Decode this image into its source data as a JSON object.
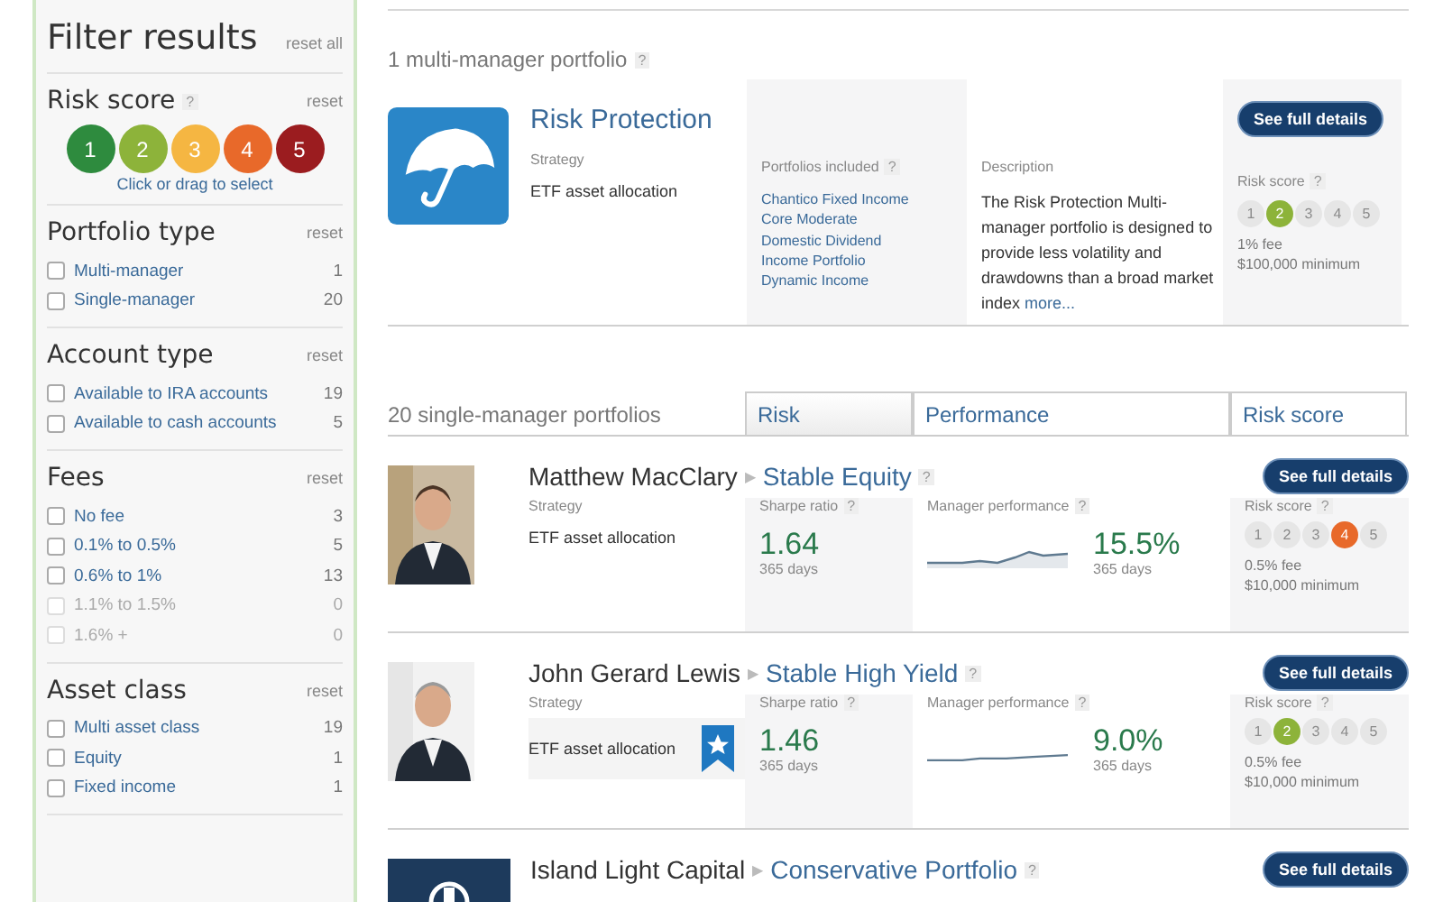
{
  "sidebar": {
    "title": "Filter results",
    "reset_all": "reset all",
    "risk": {
      "title": "Risk score",
      "help": "?",
      "reset": "reset",
      "scores": [
        {
          "label": "1",
          "color": "#2e8b3e"
        },
        {
          "label": "2",
          "color": "#8db33a"
        },
        {
          "label": "3",
          "color": "#f5b642"
        },
        {
          "label": "4",
          "color": "#e8692a"
        },
        {
          "label": "5",
          "color": "#9b1c1f"
        }
      ],
      "hint": "Click or drag to select"
    },
    "groups": [
      {
        "title": "Portfolio type",
        "reset": "reset",
        "options": [
          {
            "label": "Multi-manager",
            "count": "1",
            "checked": false,
            "disabled": false
          },
          {
            "label": "Single-manager",
            "count": "20",
            "checked": false,
            "disabled": false
          }
        ]
      },
      {
        "title": "Account type",
        "reset": "reset",
        "options": [
          {
            "label": "Available to IRA accounts",
            "count": "19",
            "checked": false,
            "disabled": false
          },
          {
            "label": "Available to cash accounts",
            "count": "5",
            "checked": false,
            "disabled": false
          }
        ]
      },
      {
        "title": "Fees",
        "reset": "reset",
        "options": [
          {
            "label": "No fee",
            "count": "3",
            "checked": false,
            "disabled": false
          },
          {
            "label": "0.1% to 0.5%",
            "count": "5",
            "checked": false,
            "disabled": false
          },
          {
            "label": "0.6% to 1%",
            "count": "13",
            "checked": false,
            "disabled": false
          },
          {
            "label": "1.1% to 1.5%",
            "count": "0",
            "checked": false,
            "disabled": true
          },
          {
            "label": "1.6% +",
            "count": "0",
            "checked": false,
            "disabled": true
          }
        ]
      },
      {
        "title": "Asset class",
        "reset": "reset",
        "options": [
          {
            "label": "Multi asset class",
            "count": "19",
            "checked": false,
            "disabled": false
          },
          {
            "label": "Equity",
            "count": "1",
            "checked": false,
            "disabled": false
          },
          {
            "label": "Fixed income",
            "count": "1",
            "checked": false,
            "disabled": false
          }
        ]
      }
    ]
  },
  "multi": {
    "heading": "1 multi-manager portfolio",
    "help": "?",
    "card": {
      "name": "Risk Protection",
      "strategy_label": "Strategy",
      "strategy": "ETF asset allocation",
      "portfolios_label": "Portfolios included",
      "portfolios_help": "?",
      "risk_help": "?",
      "portfolios": [
        "Chantico Fixed Income",
        "Core Moderate",
        "Domestic Dividend",
        "Income Portfolio",
        "Dynamic Income"
      ],
      "description_label": "Description",
      "description": "The Risk Protection Multi-manager portfolio is designed to provide less volatility and drawdowns than a broad market index",
      "more": "more...",
      "button": "See full details",
      "risk_label": "Risk score",
      "risk_dots": [
        {
          "label": "1",
          "selected": false
        },
        {
          "label": "2",
          "selected": true
        },
        {
          "label": "3",
          "selected": false
        },
        {
          "label": "4",
          "selected": false
        },
        {
          "label": "5",
          "selected": false
        }
      ],
      "fee": "1% fee",
      "minimum": "$100,000 minimum"
    }
  },
  "single": {
    "heading": "20 single-manager portfolios",
    "tabs": [
      {
        "label": "Risk",
        "selected": true
      },
      {
        "label": "Performance",
        "selected": false
      },
      {
        "label": "Risk score",
        "selected": false
      }
    ],
    "rows": [
      {
        "manager": "Matthew MacClary",
        "sep": "▶",
        "portfolio": "Stable Equity",
        "help": "?",
        "sharpe_help": "?",
        "perf_help": "?",
        "risk_help": "?",
        "strategy_label": "Strategy",
        "strategy": "ETF asset allocation",
        "featured": false,
        "sharpe_label": "Sharpe ratio",
        "sharpe": "1.64",
        "sharpe_period": "365 days",
        "perf_label": "Manager performance",
        "perf": "15.5%",
        "perf_period": "365 days",
        "button": "See full details",
        "risk_label": "Risk score",
        "risk_dots": [
          {
            "label": "1",
            "selected": false
          },
          {
            "label": "2",
            "selected": false
          },
          {
            "label": "3",
            "selected": false
          },
          {
            "label": "4",
            "selected": true
          },
          {
            "label": "5",
            "selected": false
          }
        ],
        "fee": "0.5% fee",
        "minimum": "$10,000 minimum"
      },
      {
        "manager": "John Gerard Lewis",
        "sep": "▶",
        "portfolio": "Stable High Yield",
        "help": "?",
        "sharpe_help": "?",
        "perf_help": "?",
        "risk_help": "?",
        "strategy_label": "Strategy",
        "strategy": "ETF asset allocation",
        "featured": true,
        "sharpe_label": "Sharpe ratio",
        "sharpe": "1.46",
        "sharpe_period": "365 days",
        "perf_label": "Manager performance",
        "perf": "9.0%",
        "perf_period": "365 days",
        "button": "See full details",
        "risk_label": "Risk score",
        "risk_dots": [
          {
            "label": "1",
            "selected": false
          },
          {
            "label": "2",
            "selected": true
          },
          {
            "label": "3",
            "selected": false
          },
          {
            "label": "4",
            "selected": false
          },
          {
            "label": "5",
            "selected": false
          }
        ],
        "fee": "0.5% fee",
        "minimum": "$10,000 minimum"
      },
      {
        "kind": "logo",
        "manager": "Island Light Capital",
        "sep": "▶",
        "portfolio": "Conservative Portfolio",
        "help": "?",
        "button": "See full details"
      }
    ]
  }
}
